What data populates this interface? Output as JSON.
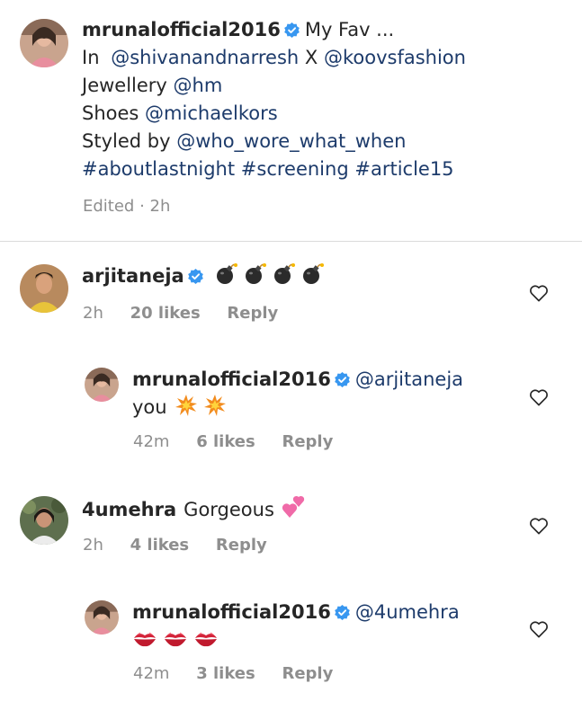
{
  "caption": {
    "username": "mrunalofficial2016",
    "lead": "My Fav ...",
    "line2_prefix": "In",
    "line2_mention1": "@shivanandnarresh",
    "line2_x": "X",
    "line2_mention2": "@koovsfashion",
    "line3_prefix": "Jewellery",
    "line3_mention": "@hm",
    "line4_prefix": "Shoes",
    "line4_mention": "@michaelkors",
    "line5_prefix": "Styled by",
    "line5_mention": "@who_wore_what_when",
    "hashtags": [
      "#aboutlastnight",
      "#screening",
      "#article15"
    ],
    "meta": "Edited · 2h"
  },
  "comments": [
    {
      "username": "arjitaneja",
      "emoji": "bomb",
      "time": "2h",
      "likes": "20 likes",
      "reply": "Reply"
    },
    {
      "username": "mrunalofficial2016",
      "mention": "@arjitaneja",
      "text": "you",
      "emoji": "collision",
      "time": "42m",
      "likes": "6 likes",
      "reply": "Reply"
    },
    {
      "username": "4umehra",
      "text": "Gorgeous",
      "emoji": "two-hearts",
      "time": "2h",
      "likes": "4 likes",
      "reply": "Reply"
    },
    {
      "username": "mrunalofficial2016",
      "mention": "@4umehra",
      "emoji": "kiss-mark",
      "time": "42m",
      "likes": "3 likes",
      "reply": "Reply"
    }
  ],
  "colors": {
    "text": "#262626",
    "mention": "#1d3b6b",
    "meta": "#8e8e8e",
    "verified": "#3897f0",
    "divider": "#dbdbdb"
  }
}
